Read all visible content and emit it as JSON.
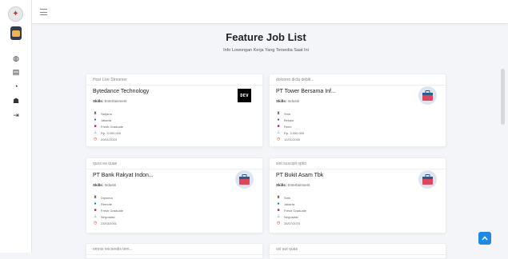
{
  "app": {
    "logo_icon": "app-logo-icon",
    "avatar_icon": "user-avatar-icon"
  },
  "sidebar": {
    "items": [
      {
        "icon": "dashboard-icon",
        "glyph": "◍"
      },
      {
        "icon": "document-icon",
        "glyph": "▤"
      },
      {
        "icon": "users-icon",
        "glyph": "◔"
      },
      {
        "icon": "user-icon",
        "glyph": "☗"
      },
      {
        "icon": "logout-icon",
        "glyph": "⇥"
      }
    ]
  },
  "topbar": {
    "menu_icon": "hamburger-icon"
  },
  "main": {
    "title": "Feature Job List",
    "subtitle": "Info Lowongan Kerja Yang Tersedia Saat Ini",
    "jobs": [
      {
        "header": "Host Live Streamer",
        "company": "Bytedance Technology",
        "skills_label": "Skills:",
        "skills": "Entertainment",
        "education": "Sarjana",
        "location": "Jakarta",
        "type": "Fresh Graduate",
        "salary": "Rp. 3.000.000",
        "date": "20/01/2023",
        "logo": "DEV"
      },
      {
        "header": "dolorem dicta debiti...",
        "company": "PT Tower Bersama Inf...",
        "skills_label": "Skills:",
        "skills": "Industri",
        "education": "Smk",
        "location": "Bekasi",
        "type": "Remi",
        "salary": "Rp. 3.500.000",
        "date": "12/01/2000",
        "logo": "briefcase"
      },
      {
        "header": "quos ea quae",
        "company": "PT Bank Rakyat Indon...",
        "skills_label": "Skills:",
        "skills": "Industri",
        "education": "Diploma",
        "location": "Remote",
        "type": "Fresh Graduate",
        "salary": "Negosiasi",
        "date": "23/03/2001",
        "logo": "briefcase"
      },
      {
        "header": "sint suscipit optio",
        "company": "PT Bukit Asam Tbk",
        "skills_label": "Skills:",
        "skills": "Entertainment",
        "education": "Smk",
        "location": "Jakarta",
        "type": "Fresh Graduate",
        "salary": "Negosiasi",
        "date": "26/07/2070",
        "logo": "briefcase"
      },
      {
        "header": "omnis reiciendis tem..."
      },
      {
        "header": "vel aut quae"
      }
    ]
  },
  "scroll_top_icon": "arrow-up-icon"
}
